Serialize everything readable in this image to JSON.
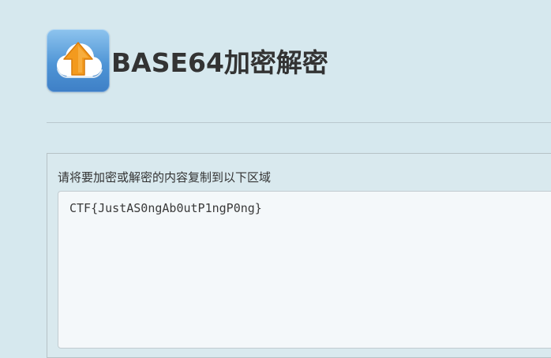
{
  "header": {
    "title": "BASE64加密解密",
    "logo_icon": "cloud-upload-icon",
    "logo_colors": {
      "background_top": "#8ec4ee",
      "background_bottom": "#3e7fc6",
      "cloud": "#ffffff",
      "arrow": "#f39a1e"
    }
  },
  "main": {
    "input_label": "请将要加密或解密的内容复制到以下区域",
    "input_value": "CTF{JustAS0ngAb0utP1ngP0ng}"
  },
  "colors": {
    "page_background": "#d6e8ee",
    "text": "#333333",
    "textarea_background": "#f4f8fa"
  }
}
